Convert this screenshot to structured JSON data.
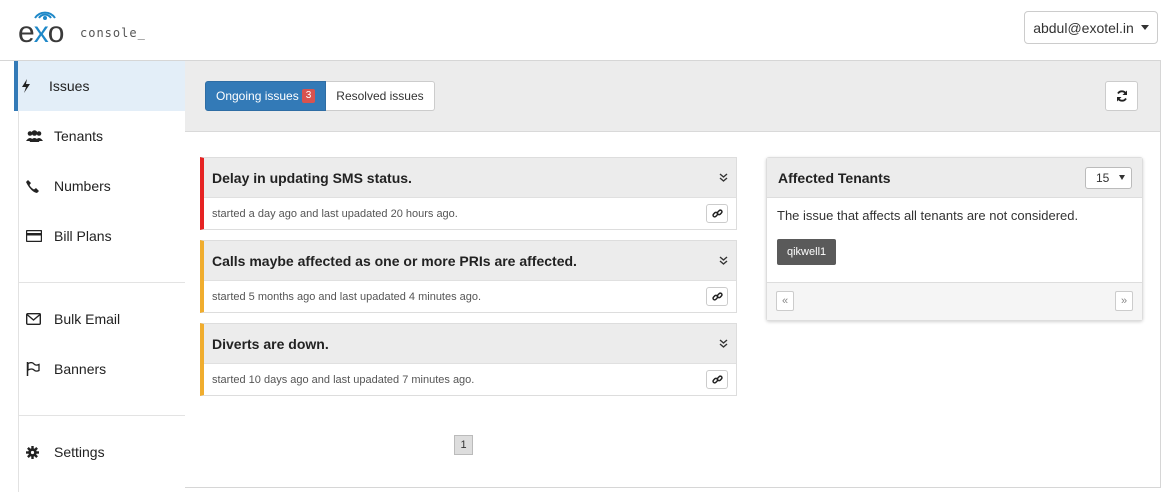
{
  "header": {
    "logo_text": "exo",
    "logo_sub": "console_",
    "user_label": "abdul@exotel.in"
  },
  "sidebar": {
    "items": [
      {
        "label": "Issues",
        "icon": "bolt-icon"
      },
      {
        "label": "Tenants",
        "icon": "users-icon"
      },
      {
        "label": "Numbers",
        "icon": "phone-icon"
      },
      {
        "label": "Bill Plans",
        "icon": "credit-card-icon"
      },
      {
        "label": "Bulk Email",
        "icon": "envelope-icon"
      },
      {
        "label": "Banners",
        "icon": "flag-icon"
      },
      {
        "label": "Settings",
        "icon": "gear-icon"
      }
    ]
  },
  "toolbar": {
    "ongoing_label": "Ongoing issues",
    "ongoing_count": "3",
    "resolved_label": "Resolved issues",
    "refresh_icon": "refresh-icon"
  },
  "issues": [
    {
      "title": "Delay in updating SMS status.",
      "meta": "started a day ago and last upadated 20 hours ago.",
      "severity_color": "#e62323"
    },
    {
      "title": "Calls maybe affected as one or more PRIs are affected.",
      "meta": "started 5 months ago and last upadated 4 minutes ago.",
      "severity_color": "#f0ad2e"
    },
    {
      "title": "Diverts are down.",
      "meta": "started 10 days ago and last upadated 7 minutes ago.",
      "severity_color": "#f0ad2e"
    }
  ],
  "pagination": {
    "current_page": "1"
  },
  "affected_tenants": {
    "title": "Affected Tenants",
    "page_size": "15",
    "note": "The issue that affects all tenants are not considered.",
    "tenants": [
      "qikwell1"
    ],
    "prev_label": "«",
    "next_label": "»"
  },
  "colors": {
    "accent": "#337ab7",
    "badge": "#d9534f"
  }
}
